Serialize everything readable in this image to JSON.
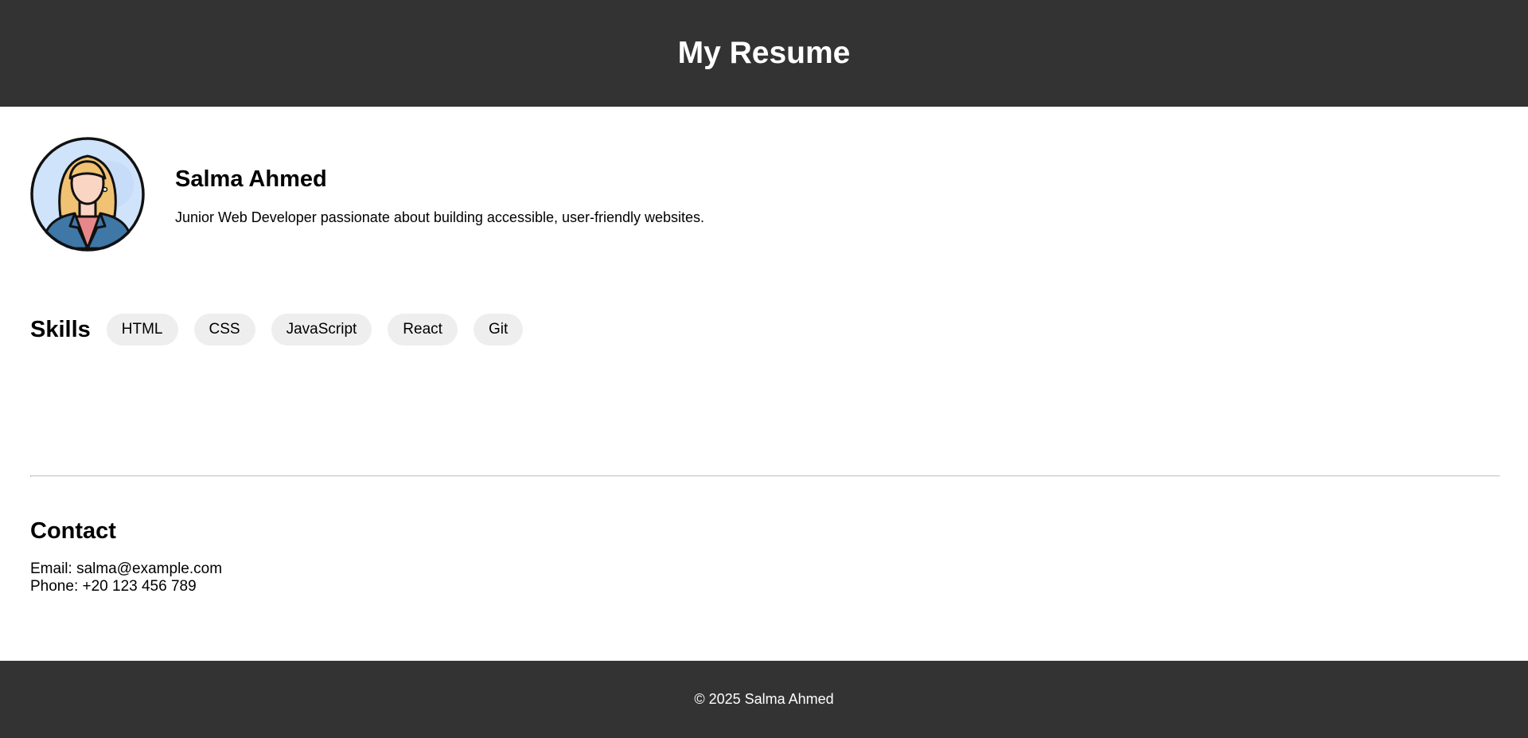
{
  "header": {
    "title": "My Resume"
  },
  "profile": {
    "avatar_icon": "woman-avatar-icon",
    "name": "Salma Ahmed",
    "bio": "Junior Web Developer passionate about building accessible, user-friendly websites."
  },
  "skills": {
    "heading": "Skills",
    "items": [
      "HTML",
      "CSS",
      "JavaScript",
      "React",
      "Git"
    ]
  },
  "contact": {
    "heading": "Contact",
    "email_line": "Email: salma@example.com",
    "phone_line": "Phone: +20 123 456 789"
  },
  "footer": {
    "text": "© 2025 Salma Ahmed"
  },
  "colors": {
    "header_bg": "#333333",
    "footer_bg": "#333333",
    "tag_bg": "#eeeeee",
    "avatar_bg": "#cfe3fb",
    "divider": "#cccccc"
  }
}
